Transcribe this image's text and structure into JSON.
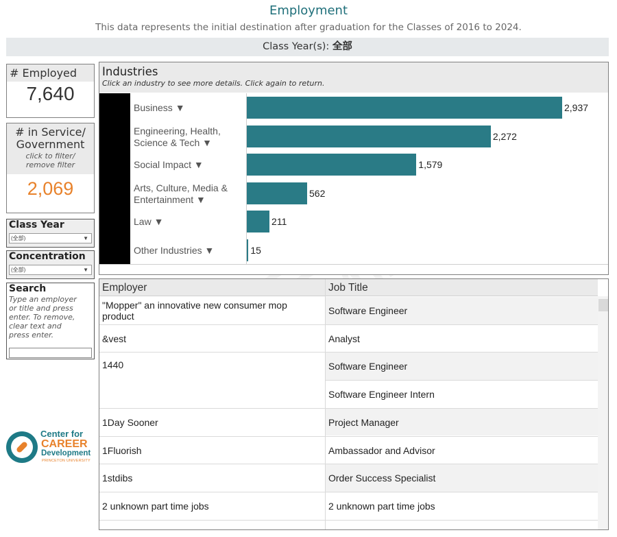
{
  "header": {
    "title": "Employment",
    "subtitle": "This data represents the initial destination after graduation for the Classes of 2016 to 2024.",
    "class_label": "Class Year(s): ",
    "class_value": "全部"
  },
  "kpis": {
    "employed_label": "# Employed",
    "employed_value": "7,640",
    "service_label_1": "# in Service/",
    "service_label_2": "Government",
    "service_hint_1": "click to filter/",
    "service_hint_2": "remove filter",
    "service_value": "2,069",
    "service_color": "#e8822b"
  },
  "filters": {
    "class_year_title": "Class Year",
    "class_year_value": "(全部)",
    "concentration_title": "Concentration",
    "concentration_value": "(全部)"
  },
  "search": {
    "title": "Search",
    "hint_1": "Type an employer",
    "hint_2": "or title and press",
    "hint_3": "enter. To remove,",
    "hint_4": "clear text and",
    "hint_5": "press enter.",
    "value": ""
  },
  "logo": {
    "line1": "Center for",
    "line2": "CAREER",
    "line3": "Development",
    "line4": "PRINCETON UNIVERSITY"
  },
  "industries": {
    "title": "Industries",
    "hint": "Click an industry to see more details.  Click again to return.",
    "bar_color": "#2a7b86",
    "items": [
      {
        "line1": "Business ▼",
        "line2": "",
        "value": 2937,
        "label": "2,937"
      },
      {
        "line1": "Engineering, Health,",
        "line2": "Science & Tech ▼",
        "value": 2272,
        "label": "2,272"
      },
      {
        "line1": "Social Impact ▼",
        "line2": "",
        "value": 1579,
        "label": "1,579"
      },
      {
        "line1": "Arts, Culture, Media &",
        "line2": "Entertainment ▼",
        "value": 562,
        "label": "562"
      },
      {
        "line1": "Law ▼",
        "line2": "",
        "value": 211,
        "label": "211"
      },
      {
        "line1": "Other Industries ▼",
        "line2": "",
        "value": 15,
        "label": "15"
      }
    ]
  },
  "table": {
    "col_employer": "Employer",
    "col_job": "Job Title",
    "rows": [
      {
        "employer_1": "\"Mopper\" an innovative new consumer mop",
        "employer_2": "product",
        "job": "Software Engineer"
      },
      {
        "employer_1": "&vest",
        "employer_2": "",
        "job": "Analyst"
      },
      {
        "employer_1": "1440",
        "employer_2": "",
        "job": "Software Engineer"
      },
      {
        "employer_1": "",
        "employer_2": "",
        "job": "Software Engineer Intern"
      },
      {
        "employer_1": "1Day Sooner",
        "employer_2": "",
        "job": "Project Manager"
      },
      {
        "employer_1": "1Fluorish",
        "employer_2": "",
        "job": "Ambassador and Advisor"
      },
      {
        "employer_1": "1stdibs",
        "employer_2": "",
        "job": "Order Success Specialist"
      },
      {
        "employer_1": "2 unknown part time jobs",
        "employer_2": "",
        "job": "2 unknown part time jobs"
      }
    ]
  },
  "watermark": "棕榈大道"
}
